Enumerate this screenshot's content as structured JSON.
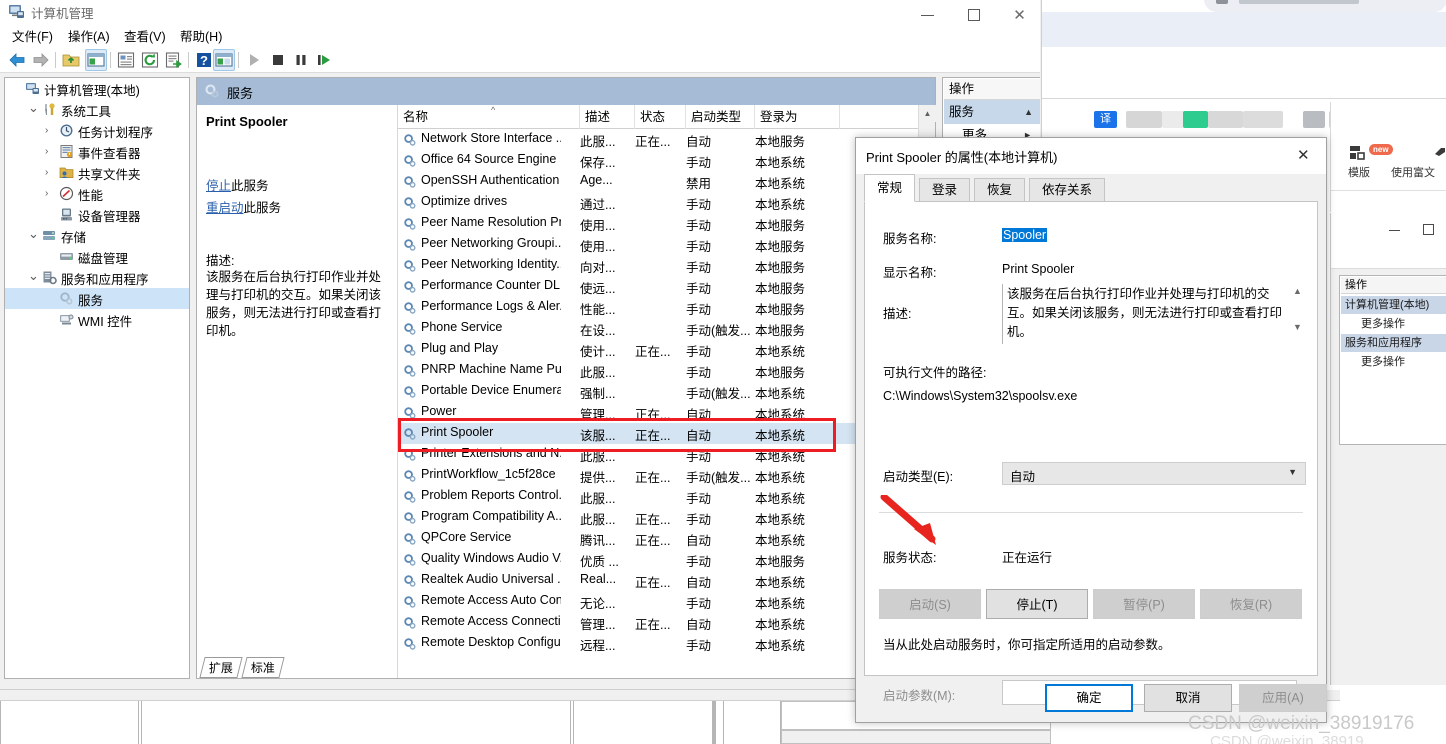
{
  "window": {
    "title": "计算机管理",
    "icon": "computer-management-icon",
    "minimize": "—",
    "maximize": "□",
    "close": "✕"
  },
  "menubar": [
    "文件(F)",
    "操作(A)",
    "查看(V)",
    "帮助(H)"
  ],
  "toolbar": {
    "icons": [
      "back-arrow-icon",
      "forward-arrow-icon",
      "up-folder-icon",
      "show-hide-tree-icon",
      "properties-icon",
      "refresh-icon",
      "export-list-icon",
      "help-icon",
      "show-action-pane-icon",
      "start-service-icon",
      "stop-service-icon",
      "pause-service-icon",
      "restart-service-icon"
    ]
  },
  "tree": {
    "items": [
      {
        "label": "计算机管理(本地)",
        "indent": 0,
        "chev": "",
        "icon": "computer-icon",
        "selected": false
      },
      {
        "label": "系统工具",
        "indent": 1,
        "chev": "v",
        "icon": "tools-icon",
        "selected": false
      },
      {
        "label": "任务计划程序",
        "indent": 2,
        "chev": ">",
        "icon": "clock-icon",
        "selected": false
      },
      {
        "label": "事件查看器",
        "indent": 2,
        "chev": ">",
        "icon": "event-viewer-icon",
        "selected": false
      },
      {
        "label": "共享文件夹",
        "indent": 2,
        "chev": ">",
        "icon": "shared-folder-icon",
        "selected": false
      },
      {
        "label": "性能",
        "indent": 2,
        "chev": ">",
        "icon": "performance-icon",
        "selected": false
      },
      {
        "label": "设备管理器",
        "indent": 2,
        "chev": "",
        "icon": "device-manager-icon",
        "selected": false
      },
      {
        "label": "存储",
        "indent": 1,
        "chev": "v",
        "icon": "storage-icon",
        "selected": false
      },
      {
        "label": "磁盘管理",
        "indent": 2,
        "chev": "",
        "icon": "disk-icon",
        "selected": false
      },
      {
        "label": "服务和应用程序",
        "indent": 1,
        "chev": "v",
        "icon": "services-apps-icon",
        "selected": false
      },
      {
        "label": "服务",
        "indent": 2,
        "chev": "",
        "icon": "service-gear-icon",
        "selected": true
      },
      {
        "label": "WMI 控件",
        "indent": 2,
        "chev": "",
        "icon": "wmi-icon",
        "selected": false
      }
    ]
  },
  "services_pane": {
    "header": "服务",
    "header_icon": "service-gear-icon",
    "detail": {
      "title": "Print Spooler",
      "stop_link": "停止",
      "stop_suffix": "此服务",
      "restart_link": "重启动",
      "restart_suffix": "此服务",
      "description_label": "描述:",
      "description": "该服务在后台执行打印作业并处理与打印机的交互。如果关闭该服务，则无法进行打印或查看打印机。"
    },
    "columns": [
      "名称",
      "描述",
      "状态",
      "启动类型",
      "登录为"
    ],
    "sort_indicator": "^",
    "rows": [
      {
        "name": "Network Store Interface ...",
        "desc": "此服...",
        "status": "正在...",
        "start": "自动",
        "logon": "本地服务",
        "selected": false
      },
      {
        "name": "Office 64 Source Engine",
        "desc": "保存...",
        "status": "",
        "start": "手动",
        "logon": "本地系统",
        "selected": false
      },
      {
        "name": "OpenSSH Authentication ...",
        "desc": "Age...",
        "status": "",
        "start": "禁用",
        "logon": "本地系统",
        "selected": false
      },
      {
        "name": "Optimize drives",
        "desc": "通过...",
        "status": "",
        "start": "手动",
        "logon": "本地系统",
        "selected": false
      },
      {
        "name": "Peer Name Resolution Pr...",
        "desc": "使用...",
        "status": "",
        "start": "手动",
        "logon": "本地服务",
        "selected": false
      },
      {
        "name": "Peer Networking Groupi...",
        "desc": "使用...",
        "status": "",
        "start": "手动",
        "logon": "本地服务",
        "selected": false
      },
      {
        "name": "Peer Networking Identity...",
        "desc": "向对...",
        "status": "",
        "start": "手动",
        "logon": "本地服务",
        "selected": false
      },
      {
        "name": "Performance Counter DL...",
        "desc": "使远...",
        "status": "",
        "start": "手动",
        "logon": "本地服务",
        "selected": false
      },
      {
        "name": "Performance Logs & Aler...",
        "desc": "性能...",
        "status": "",
        "start": "手动",
        "logon": "本地服务",
        "selected": false
      },
      {
        "name": "Phone Service",
        "desc": "在设...",
        "status": "",
        "start": "手动(触发...",
        "logon": "本地服务",
        "selected": false
      },
      {
        "name": "Plug and Play",
        "desc": "使计...",
        "status": "正在...",
        "start": "手动",
        "logon": "本地系统",
        "selected": false
      },
      {
        "name": "PNRP Machine Name Pu...",
        "desc": "此服...",
        "status": "",
        "start": "手动",
        "logon": "本地服务",
        "selected": false
      },
      {
        "name": "Portable Device Enumera...",
        "desc": "强制...",
        "status": "",
        "start": "手动(触发...",
        "logon": "本地系统",
        "selected": false
      },
      {
        "name": "Power",
        "desc": "管理...",
        "status": "正在...",
        "start": "自动",
        "logon": "本地系统",
        "selected": false
      },
      {
        "name": "Print Spooler",
        "desc": "该服...",
        "status": "正在...",
        "start": "自动",
        "logon": "本地系统",
        "selected": true
      },
      {
        "name": "Printer Extensions and N...",
        "desc": "此服...",
        "status": "",
        "start": "手动",
        "logon": "本地系统",
        "selected": false
      },
      {
        "name": "PrintWorkflow_1c5f28ce",
        "desc": "提供...",
        "status": "正在...",
        "start": "手动(触发...",
        "logon": "本地系统",
        "selected": false
      },
      {
        "name": "Problem Reports Control...",
        "desc": "此服...",
        "status": "",
        "start": "手动",
        "logon": "本地系统",
        "selected": false
      },
      {
        "name": "Program Compatibility A...",
        "desc": "此服...",
        "status": "正在...",
        "start": "手动",
        "logon": "本地系统",
        "selected": false
      },
      {
        "name": "QPCore Service",
        "desc": "腾讯...",
        "status": "正在...",
        "start": "自动",
        "logon": "本地系统",
        "selected": false
      },
      {
        "name": "Quality Windows Audio V...",
        "desc": "优质 ...",
        "status": "",
        "start": "手动",
        "logon": "本地服务",
        "selected": false
      },
      {
        "name": "Realtek Audio Universal ...",
        "desc": "Real...",
        "status": "正在...",
        "start": "自动",
        "logon": "本地系统",
        "selected": false
      },
      {
        "name": "Remote Access Auto Con...",
        "desc": "无论...",
        "status": "",
        "start": "手动",
        "logon": "本地系统",
        "selected": false
      },
      {
        "name": "Remote Access Connecti...",
        "desc": "管理...",
        "status": "正在...",
        "start": "自动",
        "logon": "本地系统",
        "selected": false
      },
      {
        "name": "Remote Desktop Configu...",
        "desc": "远程...",
        "status": "",
        "start": "手动",
        "logon": "本地系统",
        "selected": false
      }
    ],
    "bottom_tabs": [
      "扩展",
      "标准"
    ]
  },
  "actions_pane": {
    "header": "操作",
    "group": "服务",
    "group_chev": "▲",
    "sub": "更多",
    "sub_chev": "►"
  },
  "dialog": {
    "title": "Print Spooler 的属性(本地计算机)",
    "close": "✕",
    "tabs": [
      "常规",
      "登录",
      "恢复",
      "依存关系"
    ],
    "active_tab": "常规",
    "service_name_label": "服务名称:",
    "service_name_value": "Spooler",
    "display_name_label": "显示名称:",
    "display_name_value": "Print Spooler",
    "description_label": "描述:",
    "description_value": "该服务在后台执行打印作业并处理与打印机的交互。如果关闭该服务，则无法进行打印或查看打印机。",
    "path_label": "可执行文件的路径:",
    "path_value": "C:\\Windows\\System32\\spoolsv.exe",
    "startup_type_label": "启动类型(E):",
    "startup_type_value": "自动",
    "service_status_label": "服务状态:",
    "service_status_value": "正在运行",
    "buttons": [
      {
        "label": "启动(S)",
        "enabled": false
      },
      {
        "label": "停止(T)",
        "enabled": true
      },
      {
        "label": "暂停(P)",
        "enabled": false
      },
      {
        "label": "恢复(R)",
        "enabled": false
      }
    ],
    "hint": "当从此处启动服务时，你可指定所适用的启动参数。",
    "param_label": "启动参数(M):",
    "param_value": "",
    "footer": [
      {
        "label": "确定",
        "style": "primary"
      },
      {
        "label": "取消",
        "style": "normal"
      },
      {
        "label": "应用(A)",
        "style": "disabled"
      }
    ]
  },
  "background": {
    "editor": {
      "template_label": "模版",
      "new_badge": "new",
      "rich_label": "使用富文"
    },
    "cm_right": {
      "header": "操作",
      "groups": [
        {
          "label": "计算机管理(本地)",
          "sub": "更多操作"
        },
        {
          "label": "服务和应用程序",
          "sub": "更多操作"
        }
      ],
      "minimize": "—",
      "maximize": "□"
    },
    "browser_fav_text": "译"
  },
  "watermark": {
    "line1": "CSDN @weixin_38919176",
    "line2": "CSDN @weixin_38919"
  }
}
